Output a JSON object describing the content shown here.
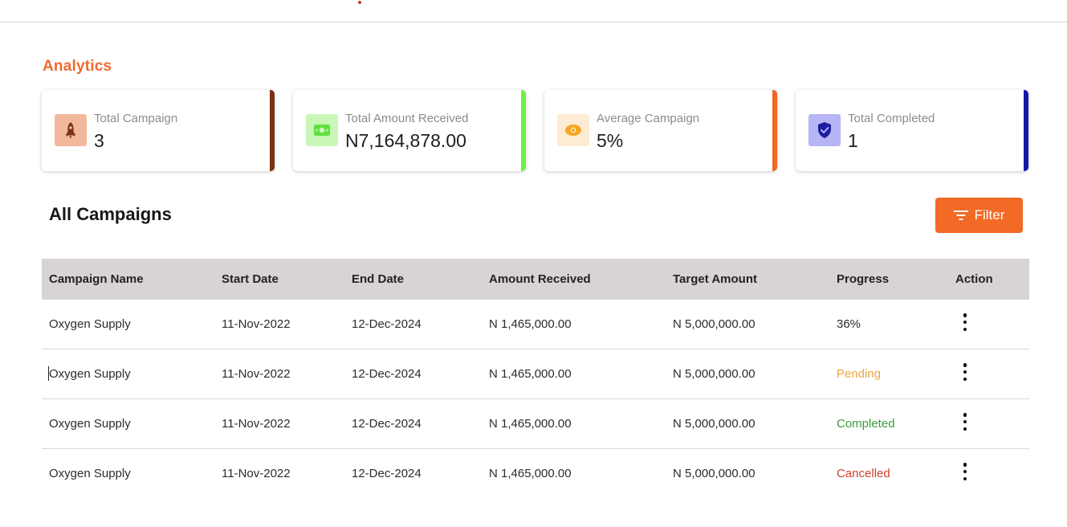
{
  "analytics": {
    "title": "Analytics",
    "cards": [
      {
        "label": "Total Campaign",
        "value": "3",
        "icon": "rocket-icon",
        "icon_bg": "#f2b89c",
        "icon_color": "#7a3316",
        "accent": "#7a3114"
      },
      {
        "label": "Total Amount Received",
        "value": "N7,164,878.00",
        "icon": "money-icon",
        "icon_bg": "#c9f7b8",
        "icon_color": "#5fe03d",
        "accent": "#6ef042"
      },
      {
        "label": "Average Campaign",
        "value": "5%",
        "icon": "eye-icon",
        "icon_bg": "#fdebd3",
        "icon_color": "#f5a623",
        "accent": "#f26522"
      },
      {
        "label": "Total Completed",
        "value": "1",
        "icon": "shield-check-icon",
        "icon_bg": "#b7b5f5",
        "icon_color": "#1d1d9e",
        "accent": "#1717a8"
      }
    ]
  },
  "campaigns": {
    "title": "All Campaigns",
    "filter_label": "Filter",
    "columns": [
      "Campaign Name",
      "Start Date",
      "End Date",
      "Amount Received",
      "Target Amount",
      "Progress",
      "Action"
    ],
    "rows": [
      {
        "name": "Oxygen Supply",
        "start": "11-Nov-2022",
        "end": "12-Dec-2024",
        "received": "N 1,465,000.00",
        "target": "N 5,000,000.00",
        "progress": "36%",
        "progress_color": "#2b2b2b"
      },
      {
        "name": "Oxygen Supply",
        "start": "11-Nov-2022",
        "end": "12-Dec-2024",
        "received": "N 1,465,000.00",
        "target": "N 5,000,000.00",
        "progress": "Pending",
        "progress_color": "#f0a33a"
      },
      {
        "name": "Oxygen Supply",
        "start": "11-Nov-2022",
        "end": "12-Dec-2024",
        "received": "N 1,465,000.00",
        "target": "N 5,000,000.00",
        "progress": "Completed",
        "progress_color": "#3a9a3a"
      },
      {
        "name": "Oxygen Supply",
        "start": "11-Nov-2022",
        "end": "12-Dec-2024",
        "received": "N 1,465,000.00",
        "target": "N 5,000,000.00",
        "progress": "Cancelled",
        "progress_color": "#d2412c"
      }
    ]
  },
  "colors": {
    "accent": "#f26a26",
    "header_bg": "#d9d4d4"
  }
}
